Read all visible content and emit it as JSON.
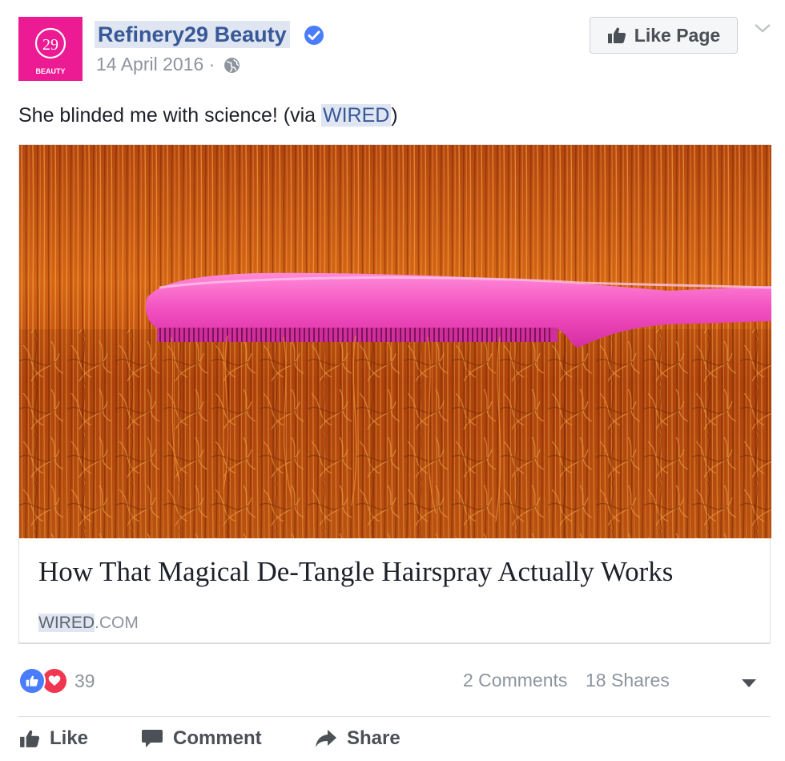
{
  "post": {
    "page_name": "Refinery29 Beauty",
    "avatar_text": "BEAUTY",
    "date": "14 April 2016",
    "separator": "·",
    "like_page_label": "Like Page",
    "message_before": "She blinded me with science! (via ",
    "message_link": "WIRED",
    "message_after": ")"
  },
  "link_card": {
    "title": "How That Magical De-Tangle Hairspray Actually Works",
    "domain_highlight": "WIRED",
    "domain_rest": ".COM"
  },
  "stats": {
    "reaction_count": "39",
    "comments": "2 Comments",
    "shares": "18 Shares"
  },
  "actions": {
    "like": "Like",
    "comment": "Comment",
    "share": "Share"
  },
  "colors": {
    "brand_pink": "#ec1a93",
    "link_blue": "#385898",
    "like_blue": "#4a7dfc",
    "love_red": "#f0374f"
  },
  "icons": [
    "verified-badge-icon",
    "globe-icon",
    "thumbs-up-icon",
    "chevron-down-icon",
    "love-heart-icon",
    "comment-icon",
    "share-arrow-icon"
  ]
}
